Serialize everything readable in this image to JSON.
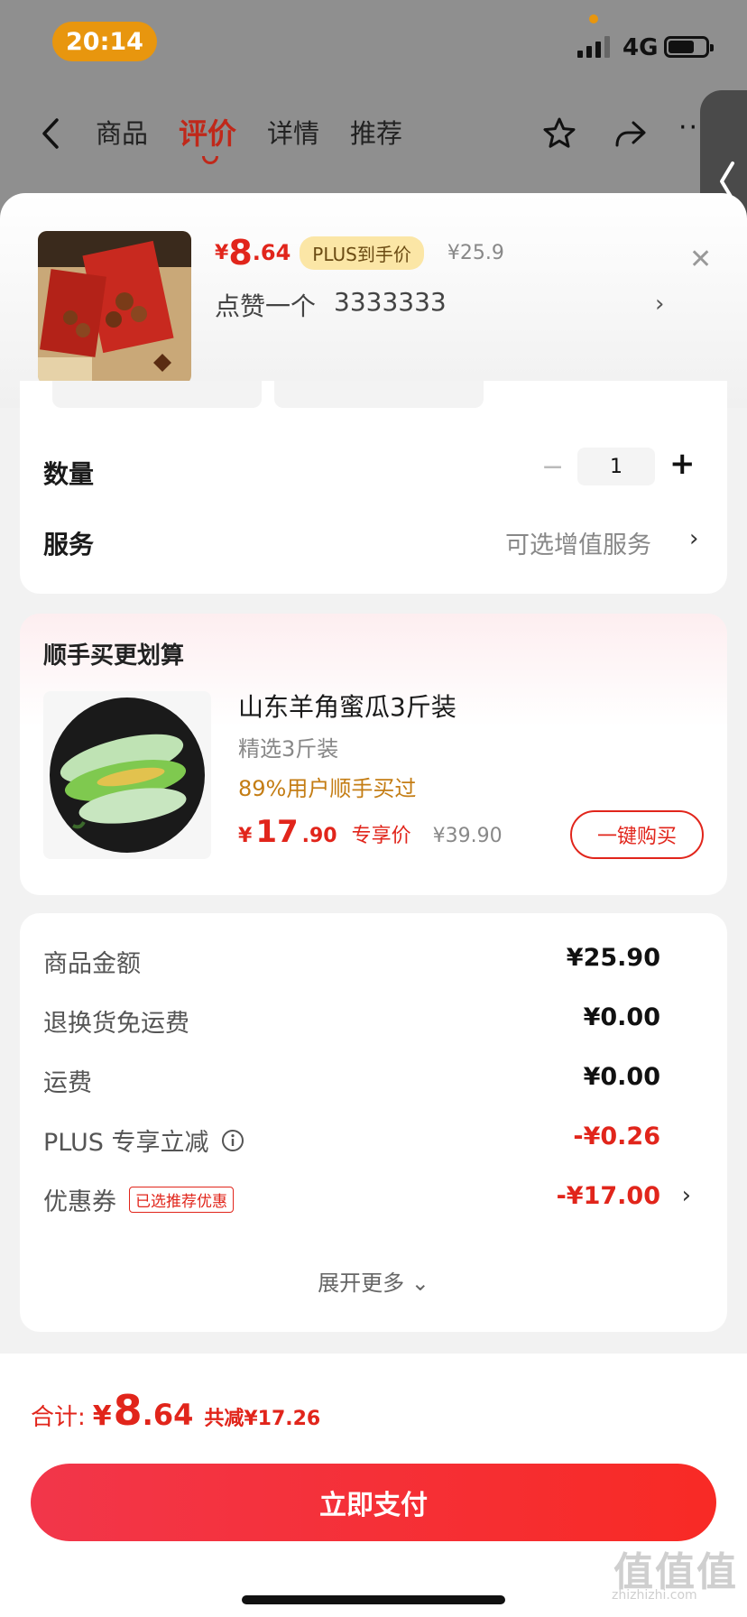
{
  "status_bar": {
    "time": "20:14",
    "network": "4G"
  },
  "nav": {
    "tabs": [
      {
        "label": "商品"
      },
      {
        "label": "评价"
      },
      {
        "label": "详情"
      },
      {
        "label": "推荐"
      }
    ],
    "active_tab": "评价",
    "more": "···"
  },
  "product": {
    "price_yen": "¥",
    "price_int": "8",
    "price_dec": ".64",
    "plus_badge": "PLUS到手价",
    "original_price": "¥25.9",
    "like_text": "点赞一个",
    "like_value": "3333333"
  },
  "spec": {
    "quantity_label": "数量",
    "quantity_value": "1",
    "minus": "−",
    "plus": "+",
    "service_label": "服务",
    "service_value": "可选增值服务"
  },
  "bundle": {
    "title": "顺手买更划算",
    "item_name": "山东羊角蜜瓜3斤装",
    "item_sub": "精选3斤装",
    "item_stat": "89%用户顺手买过",
    "price_yen": "¥",
    "price_int": "17",
    "price_dec": ".90",
    "price_tag": "专享价",
    "orig_price": "¥39.90",
    "buy_label": "一键购买"
  },
  "fees": {
    "rows": [
      {
        "label": "商品金额",
        "value": "¥25.90"
      },
      {
        "label": "退换货免运费",
        "value": "¥0.00"
      },
      {
        "label": "运费",
        "value": "¥0.00"
      },
      {
        "label": "PLUS 专享立减",
        "value": "-¥0.26"
      },
      {
        "label": "优惠券",
        "value": "-¥17.00",
        "tag": "已选推荐优惠"
      }
    ],
    "expand": "展开更多 ⌄"
  },
  "footer": {
    "total_label": "合计:",
    "total_yen": "¥",
    "total_int": "8",
    "total_dec": ".64",
    "discount": "共减¥17.26",
    "pay_label": "立即支付"
  },
  "watermark": {
    "main": "值值值",
    "sub": "zhizhizhi.com"
  },
  "colors": {
    "accent": "#e1251b",
    "status_pill": "#e8960e",
    "plus_badge": "#fbe6a6"
  }
}
